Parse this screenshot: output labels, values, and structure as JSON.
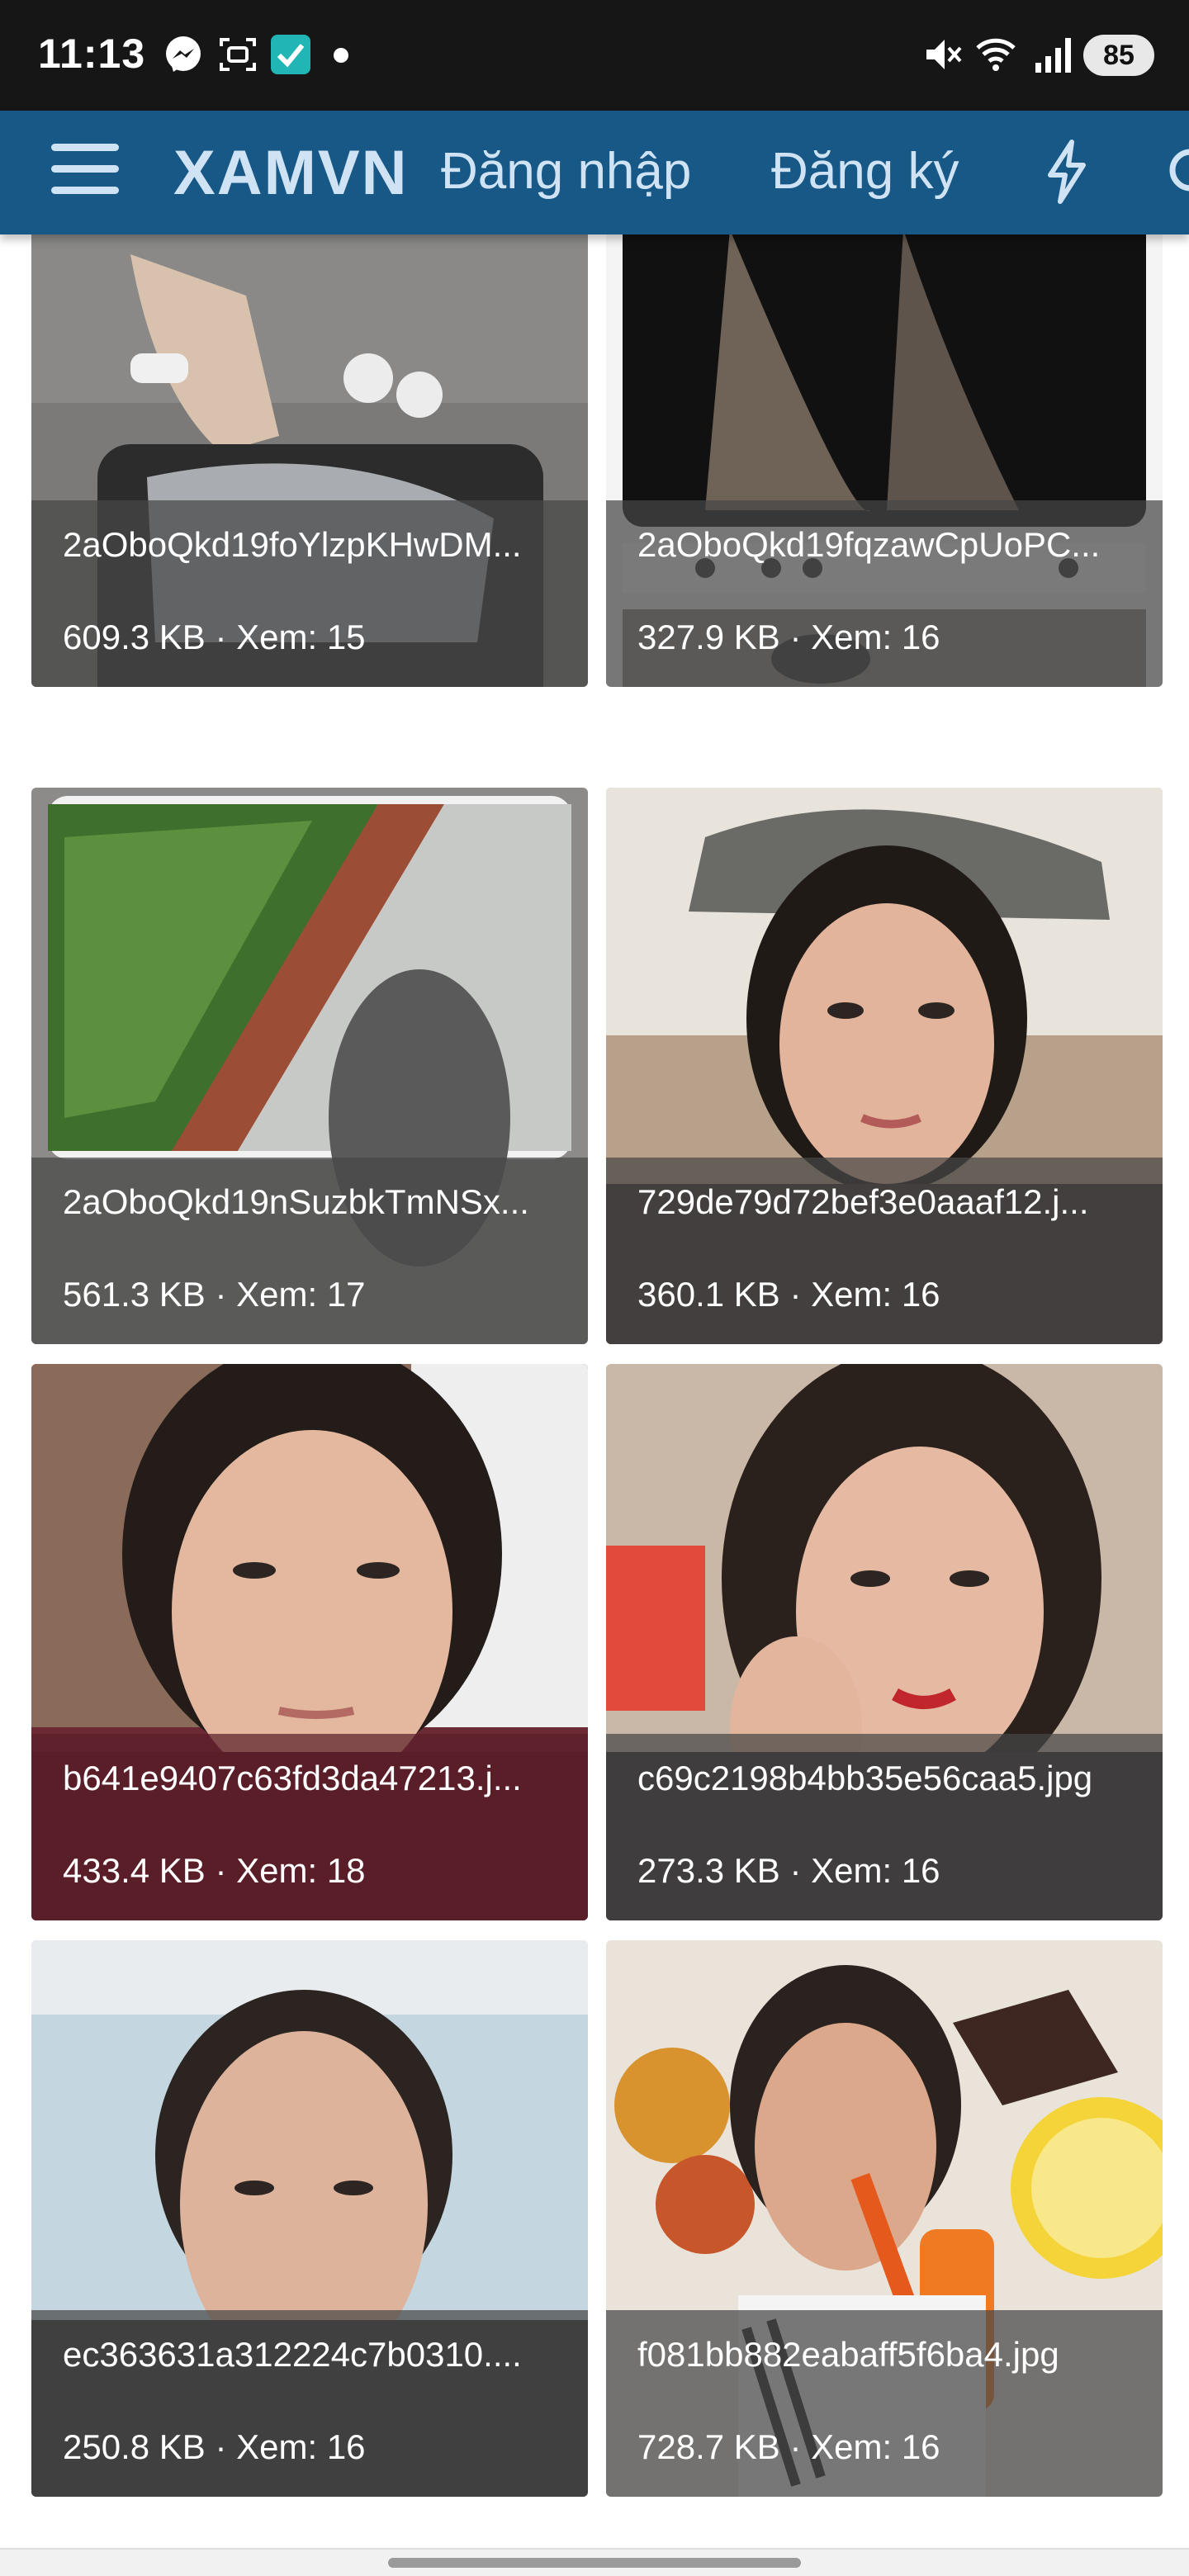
{
  "status_bar": {
    "time": "11:13",
    "battery": "85",
    "icons": [
      "messenger-icon",
      "screenshot-icon",
      "task-app-icon",
      "notification-dot",
      "mute-icon",
      "wifi-icon",
      "signal-icon",
      "battery-icon"
    ]
  },
  "header": {
    "brand": "XAMVN",
    "login": "Đăng nhập",
    "register": "Đăng ký",
    "icons": [
      "menu-icon",
      "bolt-icon",
      "search-icon"
    ],
    "background_color": "#185886",
    "text_color": "#cfe3f4"
  },
  "gallery": {
    "items": [
      {
        "filename": "2aOboQkd19foYlzpKHwDM...",
        "meta": "609.3 KB · Xem: 15"
      },
      {
        "filename": "2aOboQkd19fqzawCpUoPC...",
        "meta": "327.9 KB · Xem: 16"
      },
      {
        "filename": "2aOboQkd19nSuzbkTmNSx...",
        "meta": "561.3 KB · Xem: 17"
      },
      {
        "filename": "729de79d72bef3e0aaaf12.j...",
        "meta": "360.1 KB · Xem: 16"
      },
      {
        "filename": "b641e9407c63fd3da47213.j...",
        "meta": "433.4 KB · Xem: 18"
      },
      {
        "filename": "c69c2198b4bb35e56caa5.jpg",
        "meta": "273.3 KB · Xem: 16"
      },
      {
        "filename": "ec363631a312224c7b0310....",
        "meta": "250.8 KB · Xem: 16"
      },
      {
        "filename": "f081bb882eabaff5f6ba4.jpg",
        "meta": "728.7 KB · Xem: 16"
      }
    ]
  }
}
